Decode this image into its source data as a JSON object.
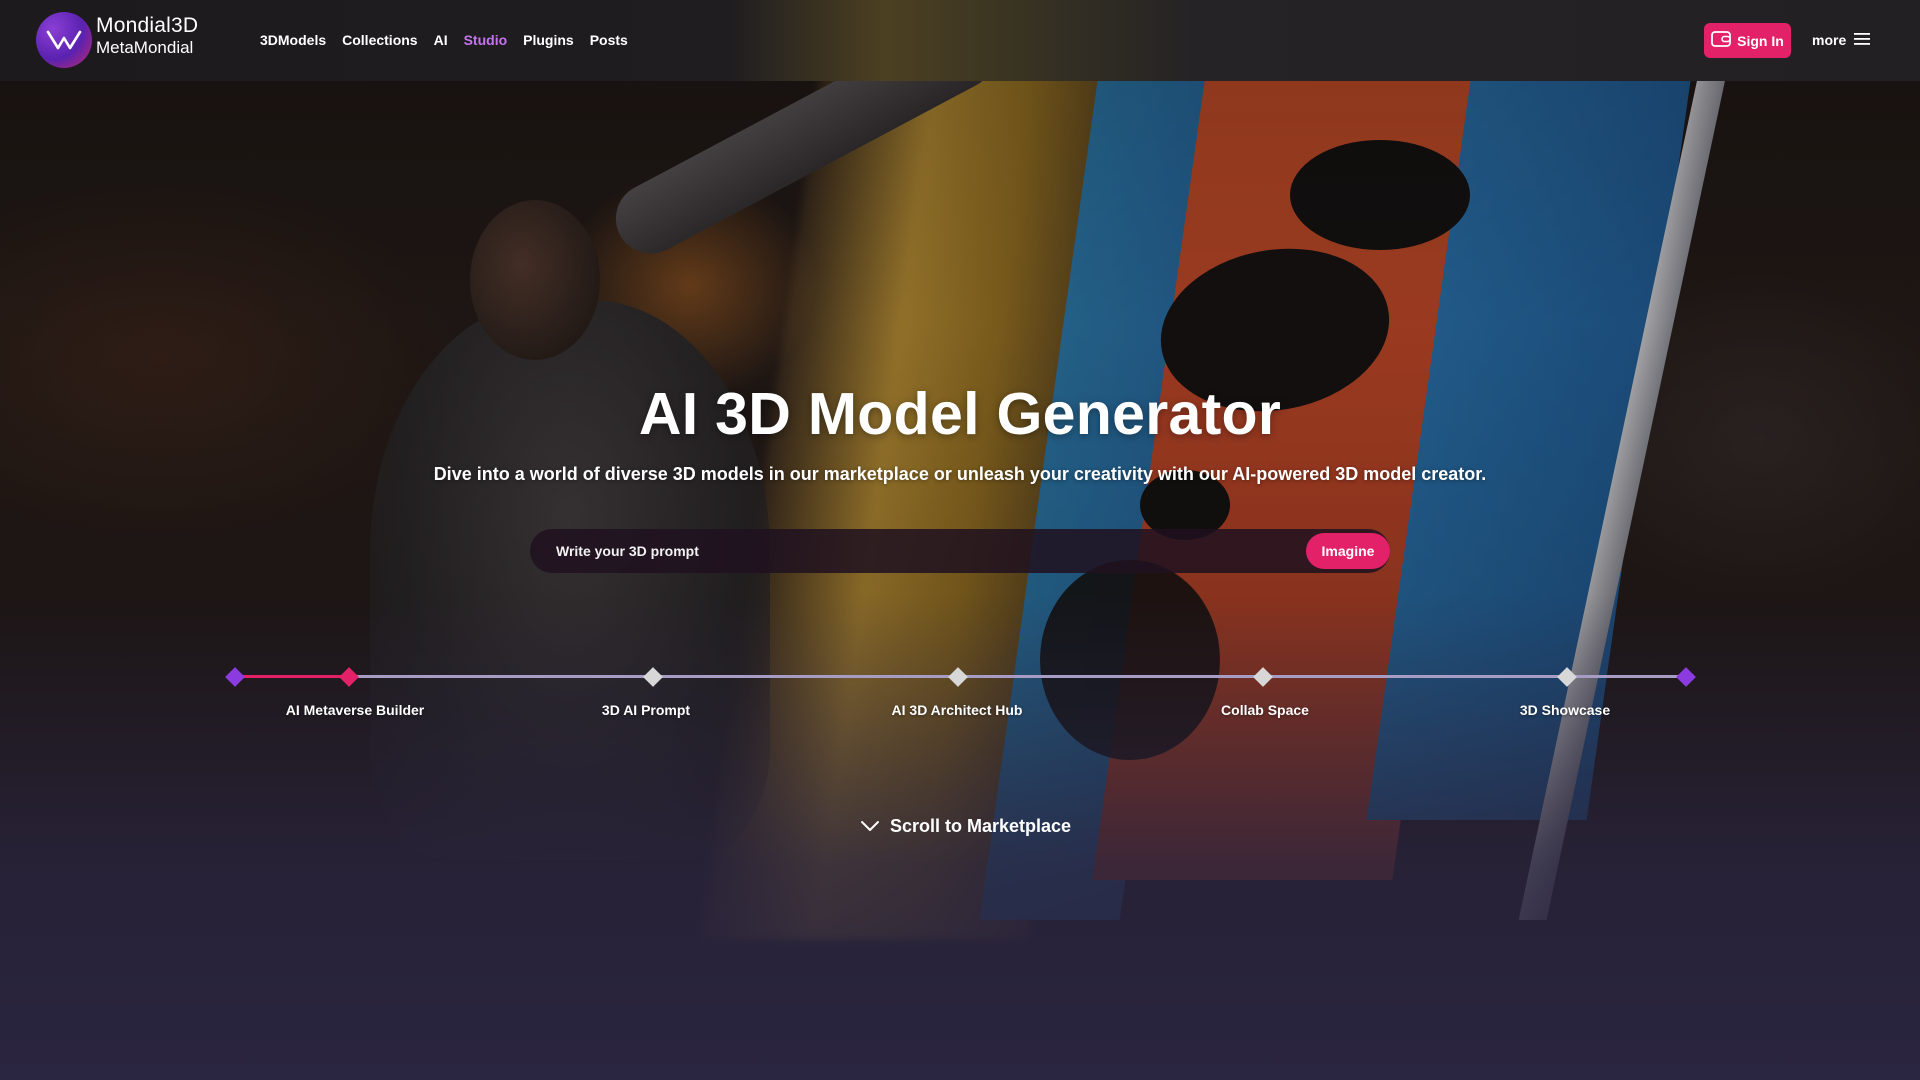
{
  "brand": {
    "name": "Mondial3D",
    "sub": "MetaMondial"
  },
  "nav": {
    "items": [
      {
        "label": "3DModels"
      },
      {
        "label": "Collections"
      },
      {
        "label": "AI"
      },
      {
        "label": "Studio",
        "active": true
      },
      {
        "label": "Plugins"
      },
      {
        "label": "Posts"
      }
    ]
  },
  "header": {
    "signin_label": "Sign In",
    "more_label": "more"
  },
  "hero": {
    "title": "AI 3D Model Generator",
    "subtitle": "Dive into a world of diverse 3D models in our marketplace or unleash your creativity with our AI-powered 3D model creator.",
    "prompt_placeholder": "Write your 3D prompt",
    "imagine_label": "Imagine"
  },
  "timeline": {
    "items": [
      {
        "label": "AI Metaverse Builder",
        "active": true
      },
      {
        "label": "3D AI Prompt"
      },
      {
        "label": "AI 3D Architect Hub"
      },
      {
        "label": "Collab Space"
      },
      {
        "label": "3D Showcase"
      }
    ]
  },
  "scroll": {
    "label": "Scroll to Marketplace"
  },
  "colors": {
    "accent": "#e32168",
    "nav_active": "#c575ef",
    "timeline_end": "#8b3be0",
    "timeline_line": "#a69cc4"
  }
}
